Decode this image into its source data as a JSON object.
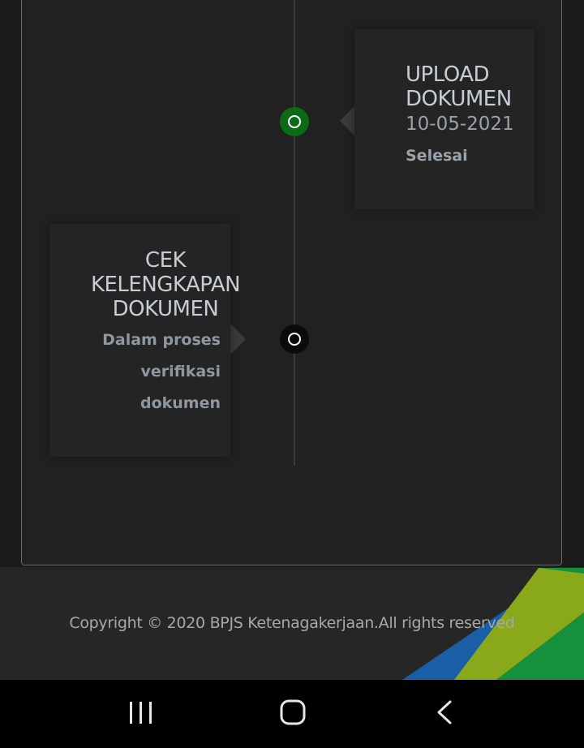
{
  "timeline": {
    "events": [
      {
        "title": "UPLOAD DOKUMEN",
        "date": "10-05-2021",
        "status": "Selesai",
        "node_color": "#0d6a17"
      },
      {
        "title": "CEK KELENGKAPAN DOKUMEN",
        "status": "Dalam proses verifikasi dokumen",
        "node_color": "#0b0b0b"
      }
    ]
  },
  "footer": {
    "copyright": "Copyright © 2020 BPJS Ketenagakerjaan.All rights reserved",
    "brand_colors": [
      "#1a5fa6",
      "#8aa91a",
      "#16903a"
    ]
  },
  "navbar": {
    "recent_icon": "recent-apps-icon",
    "home_icon": "home-icon",
    "back_icon": "back-icon"
  }
}
